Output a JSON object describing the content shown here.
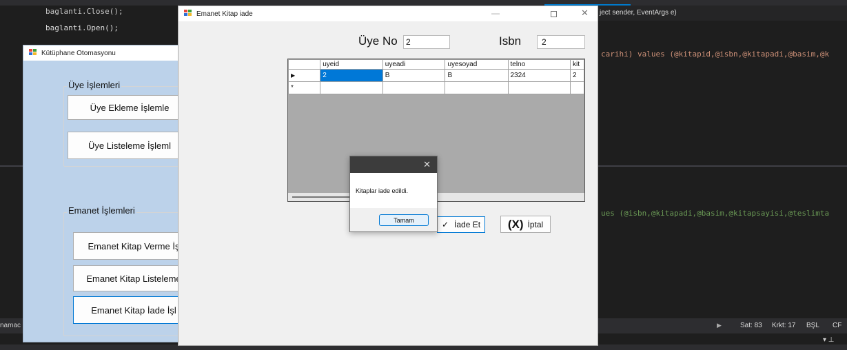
{
  "ide": {
    "code_lines": [
      "baglanti.Close();",
      "baglanti.Open();"
    ],
    "right_top_text": "ject sender, EventArgs e)",
    "right_sql_1": "carihi) values (@kitapid,@isbn,@kitapadi,@basim,@k",
    "right_sql_2": "ues (@isbn,@kitapadi,@basim,@kitapsayisi,@teslimta",
    "left_cut_text": "namac",
    "status": {
      "line": "Sat: 83",
      "col": "Krkt: 17",
      "mode": "BŞL",
      "encoding": "CF"
    }
  },
  "main_window": {
    "title": "Kütüphane Otomasyonu",
    "group_uye": "Üye İşlemleri",
    "btn_uye_ekle": "Üye Ekleme İşlemle",
    "btn_uye_listele": "Üye Listeleme İşleml",
    "group_emanet": "Emanet İşlemleri",
    "btn_emanet_verme": "Emanet Kitap Verme İş",
    "btn_emanet_listeleme": "Emanet Kitap Listeleme",
    "btn_emanet_iade": "Emanet Kitap İade İşl"
  },
  "iade_window": {
    "title": "Emanet Kitap iade",
    "uye_no_label": "Üye No",
    "uye_no_value": "2",
    "isbn_label": "Isbn",
    "isbn_value": "2",
    "grid": {
      "columns": [
        "uyeid",
        "uyeadi",
        "uyesoyad",
        "telno",
        "kit"
      ],
      "rows": [
        [
          "2",
          "B",
          "B",
          "2324",
          "2"
        ]
      ]
    },
    "btn_iade": "İade Et",
    "btn_iptal": "İptal",
    "iptal_glyph": "(X)"
  },
  "dialog": {
    "message": "Kitaplar iade edildi.",
    "ok_label": "Tamam"
  }
}
